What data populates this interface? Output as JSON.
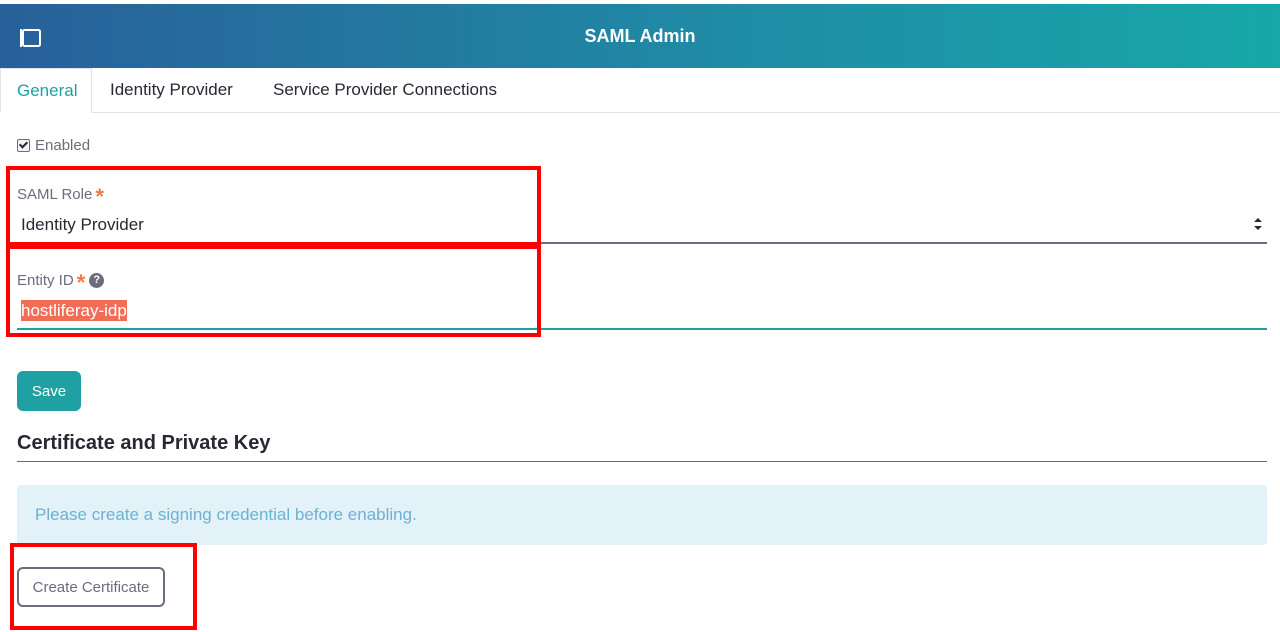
{
  "header": {
    "title": "SAML Admin",
    "toggle_icon": "panel-toggle-icon"
  },
  "tabs": [
    {
      "label": "General",
      "active": true
    },
    {
      "label": "Identity Provider",
      "active": false
    },
    {
      "label": "Service Provider Connections",
      "active": false
    }
  ],
  "form": {
    "enabled_label": "Enabled",
    "enabled_checked": true,
    "saml_role": {
      "label": "SAML Role",
      "required_mark": "*",
      "value": "Identity Provider"
    },
    "entity_id": {
      "label": "Entity ID",
      "required_mark": "*",
      "help": "?",
      "value": "hostliferay-idp"
    },
    "save_label": "Save"
  },
  "certificate": {
    "title": "Certificate and Private Key",
    "alert_text": "Please create a signing credential before enabling.",
    "create_label": "Create Certificate"
  },
  "colors": {
    "accent": "#1fa1a3",
    "required": "#f07a45",
    "highlight": "#ff0000",
    "alert_bg": "#e3f1f9",
    "alert_text": "#6cb2d3"
  }
}
